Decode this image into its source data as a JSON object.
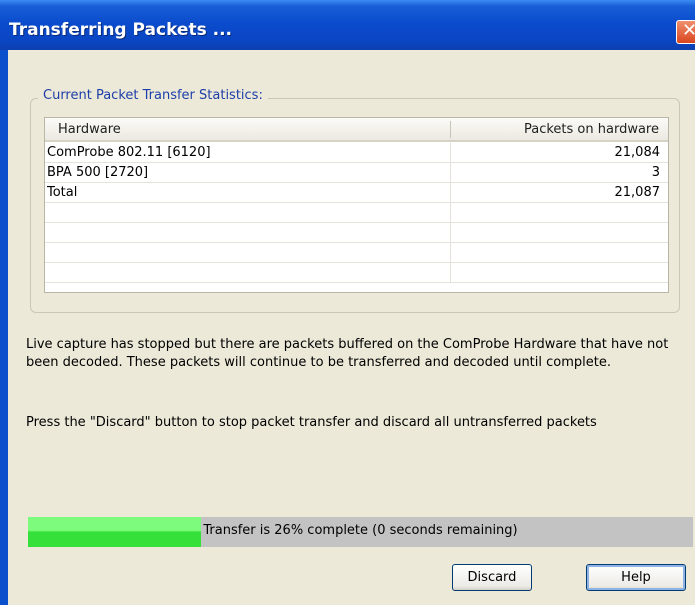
{
  "window": {
    "title": "Transferring Packets ...",
    "close_icon": "close-icon",
    "close_glyph": "✕",
    "accent_color": "#0a46c4"
  },
  "group": {
    "legend": "Current Packet Transfer Statistics:"
  },
  "table": {
    "columns": [
      "Hardware",
      "Packets on hardware"
    ],
    "rows": [
      {
        "hardware": "ComProbe 802.11 [6120]",
        "packets": "21,084"
      },
      {
        "hardware": "BPA 500 [2720]",
        "packets": "3"
      },
      {
        "hardware": "Total",
        "packets": "21,087"
      },
      {
        "hardware": "",
        "packets": ""
      },
      {
        "hardware": "",
        "packets": ""
      },
      {
        "hardware": "",
        "packets": ""
      },
      {
        "hardware": "",
        "packets": ""
      }
    ]
  },
  "messages": {
    "info": "Live capture has stopped but there are packets buffered on the ComProbe Hardware that have not been decoded.  These packets will continue to be transferred and decoded until complete.",
    "instruction": "Press the \"Discard\" button to stop packet transfer and discard all untransferred packets"
  },
  "progress": {
    "percent": 26,
    "label": "Transfer is 26% complete (0 seconds remaining)",
    "fill_color": "#36e03a"
  },
  "buttons": {
    "discard": "Discard",
    "help": "Help"
  }
}
